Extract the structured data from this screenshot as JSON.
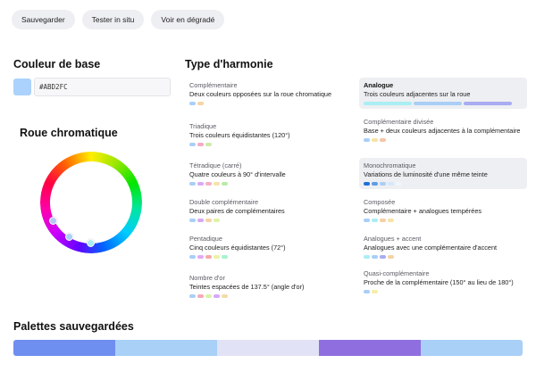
{
  "toolbar": {
    "save_label": "Sauvegarder",
    "test_label": "Tester in situ",
    "gradient_label": "Voir en dégradé"
  },
  "base_color": {
    "title": "Couleur de base",
    "hex_value": "#ABD2FC",
    "swatch_color": "#ABD2FC"
  },
  "wheel": {
    "title": "Roue chromatique"
  },
  "harmony": {
    "title": "Type d'harmonie",
    "items": [
      {
        "name": "Complémentaire",
        "desc": "Deux couleurs opposées sur la roue chromatique",
        "colors": [
          "#a9cff8",
          "#f7d4a3"
        ]
      },
      {
        "name": "Triadique",
        "desc": "Trois couleurs équidistantes (120°)",
        "colors": [
          "#a9cff8",
          "#f6a9c4",
          "#cfeaa6"
        ]
      },
      {
        "name": "Tétradique (carré)",
        "desc": "Quatre couleurs à 90° d'intervalle",
        "colors": [
          "#a9cff8",
          "#d9a9f6",
          "#f6b0c4",
          "#f6e3a6",
          "#b8eaa9"
        ]
      },
      {
        "name": "Double complémentaire",
        "desc": "Deux paires de complémentaires",
        "colors": [
          "#a9cff8",
          "#d3a9f6",
          "#f6d2a6",
          "#dff2a6"
        ]
      },
      {
        "name": "Pentadique",
        "desc": "Cinq couleurs équidistantes (72°)",
        "colors": [
          "#a9cff8",
          "#e2a9f6",
          "#f6a9a9",
          "#e9f2a6",
          "#a9f2cf"
        ]
      },
      {
        "name": "Nombre d'or",
        "desc": "Teintes espacées de 137.5° (angle d'or)",
        "colors": [
          "#a9cff8",
          "#f6a9b8",
          "#d8f2a6",
          "#d6a9f6",
          "#f6dba6"
        ]
      },
      {
        "name": "Analogue",
        "desc": "Trois couleurs adjacentes sur la roue",
        "colors": [
          "#a9eef3",
          "#a9cff8",
          "#a9abf3"
        ]
      },
      {
        "name": "Complémentaire divisée",
        "desc": "Base + deux couleurs adjacentes à la complémentaire",
        "colors": [
          "#a9cff8",
          "#f6e3a6",
          "#f6c4a6"
        ]
      },
      {
        "name": "Monochromatique",
        "desc": "Variations de luminosité d'une même teinte",
        "colors": [
          "#1f6fd6",
          "#5c9ee6",
          "#a9cff8",
          "#d4e7fc",
          "#eef5fe"
        ]
      },
      {
        "name": "Composée",
        "desc": "Complémentaire + analogues tempérées",
        "colors": [
          "#a9cff8",
          "#a9eef3",
          "#f6cfa6",
          "#f6e3a6"
        ]
      },
      {
        "name": "Analogues + accent",
        "desc": "Analogues avec une complémentaire d'accent",
        "colors": [
          "#a9eef3",
          "#a9cff8",
          "#a9abf3",
          "#f6d2a6"
        ]
      },
      {
        "name": "Quasi-complémentaire",
        "desc": "Proche de la complémentaire (150° au lieu de 180°)",
        "colors": [
          "#a9cff8",
          "#f6efa6"
        ]
      }
    ]
  },
  "palettes": {
    "title": "Palettes sauvegardées",
    "colors": [
      "#6e8ff0",
      "#a9d0f6",
      "#e2e2f6",
      "#8f6fe0",
      "#a9d0f6"
    ]
  }
}
